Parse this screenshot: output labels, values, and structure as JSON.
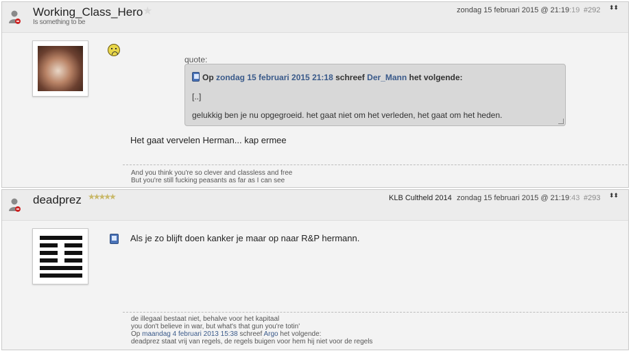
{
  "posts": [
    {
      "username": "Working_Class_Hero",
      "user_title": "Is something to be",
      "date": "zondag 15 februari 2015 @ 21:19",
      "seconds": ":19",
      "post_number": "#292",
      "avatar": "hamster-photo",
      "mood_icon": "frown-smiley-icon",
      "quote": {
        "label": "quote:",
        "prefix": "Op",
        "date_link": "zondag 15 februari 2015 21:18",
        "mid": "schreef",
        "author_link": "Der_Mann",
        "suffix": "het volgende:",
        "line1": "[..]",
        "line2": "gelukkig ben je nu opgegroeid. het gaat niet om het verleden, het gaat om het heden."
      },
      "message": "Het gaat vervelen Herman... kap ermee",
      "signature": [
        "And you think you're so clever and classless and free",
        "But you're still fucking peasants as far as I can see"
      ]
    },
    {
      "username": "deadprez",
      "rank": "KLB Cultheld 2014",
      "stars": "★★★★★",
      "date": "zondag 15 februari 2015 @ 21:19",
      "seconds": ":43",
      "post_number": "#293",
      "avatar": "i-ching-hexagram",
      "message": "Als je zo blijft doen kanker je maar op naar R&P hermann.",
      "signature": {
        "line1": "de illegaal bestaat niet, behalve voor het kapitaal",
        "line2": "you don't believe in war, but what's that gun you're totin'",
        "line3_prefix": "Op",
        "line3_link": "maandag 4 februari 2013 15:38",
        "line3_mid": "schreef",
        "line3_author": "Argo",
        "line3_suffix": "het volgende:",
        "line4": "deadprez staat vrij van regels, de regels buigen voor hem hij niet voor de regels"
      }
    }
  ],
  "ui": {
    "star": "★",
    "arrows": "⬍⬍"
  },
  "colors": {
    "link": "#3a5a8a",
    "header_bg": "#ececec",
    "post_bg": "#f3f3f3",
    "quote_bg": "#d8d8d8"
  }
}
